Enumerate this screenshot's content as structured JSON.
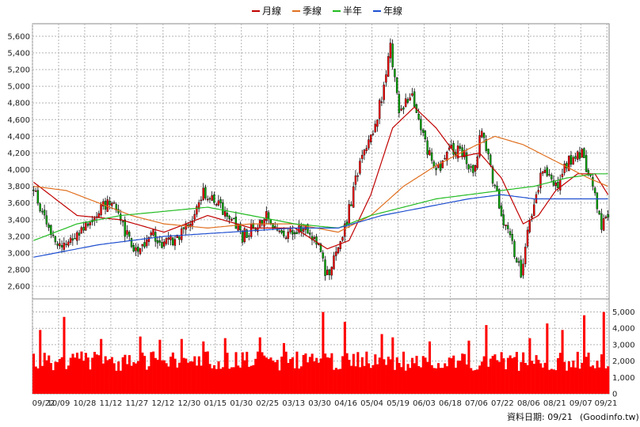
{
  "chart_data": {
    "type": "candlestick",
    "legend": {
      "placement": "top-center",
      "items": [
        {
          "name": "月線",
          "color": "#c00000"
        },
        {
          "name": "季線",
          "color": "#e07020"
        },
        {
          "name": "半年",
          "color": "#22bb22"
        },
        {
          "name": "年線",
          "color": "#1f4fd0"
        }
      ]
    },
    "colors": {
      "up": "#ff0000",
      "down": "#00aa00",
      "volume": "#ff0000",
      "grid": "#b4b4b4"
    },
    "price_axis": {
      "range": [
        2450,
        5750
      ],
      "ticks": [
        "5,600",
        "5,400",
        "5,200",
        "5,000",
        "4,800",
        "4,600",
        "4,400",
        "4,200",
        "4,000",
        "3,800",
        "3,600",
        "3,400",
        "3,200",
        "3,000",
        "2,800",
        "2,600"
      ],
      "tick_values": [
        5600,
        5400,
        5200,
        5000,
        4800,
        4600,
        4400,
        4200,
        4000,
        3800,
        3600,
        3400,
        3200,
        3000,
        2800,
        2600
      ],
      "side": "left"
    },
    "volume_axis": {
      "range": [
        0,
        5800
      ],
      "ticks": [
        "5,000",
        "4,000",
        "3,000",
        "2,000",
        "1,000",
        "0"
      ],
      "tick_values": [
        5000,
        4000,
        3000,
        2000,
        1000,
        0
      ],
      "side": "right"
    },
    "x_ticks": [
      "09/22",
      "10/09",
      "10/28",
      "11/12",
      "11/27",
      "12/12",
      "12/30",
      "01/15",
      "01/30",
      "02/25",
      "03/13",
      "03/30",
      "04/16",
      "05/04",
      "05/19",
      "06/03",
      "06/18",
      "07/06",
      "07/22",
      "08/06",
      "08/21",
      "09/07",
      "09/21"
    ],
    "x_tick_index": [
      0,
      12,
      24,
      36,
      48,
      60,
      72,
      84,
      96,
      108,
      120,
      132,
      144,
      156,
      168,
      180,
      192,
      204,
      216,
      228,
      240,
      252,
      264
    ],
    "num_days": 265,
    "price_anchors": [
      [
        0,
        3780
      ],
      [
        6,
        3350
      ],
      [
        12,
        3050
      ],
      [
        18,
        3200
      ],
      [
        24,
        3300
      ],
      [
        30,
        3500
      ],
      [
        36,
        3650
      ],
      [
        42,
        3250
      ],
      [
        48,
        3000
      ],
      [
        54,
        3250
      ],
      [
        60,
        3100
      ],
      [
        66,
        3200
      ],
      [
        72,
        3350
      ],
      [
        78,
        3750
      ],
      [
        84,
        3600
      ],
      [
        90,
        3450
      ],
      [
        96,
        3200
      ],
      [
        102,
        3350
      ],
      [
        108,
        3450
      ],
      [
        114,
        3200
      ],
      [
        120,
        3250
      ],
      [
        126,
        3300
      ],
      [
        132,
        3050
      ],
      [
        134,
        2700
      ],
      [
        138,
        2900
      ],
      [
        144,
        3400
      ],
      [
        150,
        4100
      ],
      [
        156,
        4450
      ],
      [
        162,
        5100
      ],
      [
        164,
        5500
      ],
      [
        168,
        4700
      ],
      [
        174,
        4900
      ],
      [
        180,
        4300
      ],
      [
        186,
        4000
      ],
      [
        192,
        4250
      ],
      [
        198,
        4200
      ],
      [
        202,
        3950
      ],
      [
        206,
        4500
      ],
      [
        210,
        4000
      ],
      [
        216,
        3400
      ],
      [
        220,
        3100
      ],
      [
        224,
        2750
      ],
      [
        228,
        3400
      ],
      [
        234,
        4000
      ],
      [
        240,
        3800
      ],
      [
        246,
        4100
      ],
      [
        252,
        4200
      ],
      [
        258,
        3700
      ],
      [
        261,
        3300
      ],
      [
        264,
        3500
      ]
    ],
    "ma_anchors": {
      "月線": [
        [
          0,
          3850
        ],
        [
          20,
          3450
        ],
        [
          40,
          3400
        ],
        [
          60,
          3250
        ],
        [
          80,
          3450
        ],
        [
          100,
          3300
        ],
        [
          120,
          3300
        ],
        [
          135,
          3050
        ],
        [
          145,
          3150
        ],
        [
          155,
          3700
        ],
        [
          165,
          4500
        ],
        [
          175,
          4750
        ],
        [
          185,
          4500
        ],
        [
          195,
          4150
        ],
        [
          205,
          4200
        ],
        [
          215,
          3900
        ],
        [
          225,
          3350
        ],
        [
          232,
          3450
        ],
        [
          240,
          3750
        ],
        [
          250,
          3950
        ],
        [
          258,
          3950
        ],
        [
          264,
          3700
        ]
      ],
      "季線": [
        [
          0,
          3800
        ],
        [
          15,
          3750
        ],
        [
          30,
          3600
        ],
        [
          45,
          3450
        ],
        [
          60,
          3350
        ],
        [
          80,
          3300
        ],
        [
          100,
          3350
        ],
        [
          120,
          3350
        ],
        [
          140,
          3250
        ],
        [
          155,
          3450
        ],
        [
          170,
          3800
        ],
        [
          185,
          4050
        ],
        [
          200,
          4250
        ],
        [
          212,
          4400
        ],
        [
          225,
          4300
        ],
        [
          240,
          4100
        ],
        [
          255,
          3900
        ],
        [
          264,
          3800
        ]
      ],
      "半年": [
        [
          0,
          3150
        ],
        [
          20,
          3350
        ],
        [
          40,
          3450
        ],
        [
          60,
          3500
        ],
        [
          80,
          3550
        ],
        [
          100,
          3450
        ],
        [
          120,
          3350
        ],
        [
          140,
          3300
        ],
        [
          155,
          3450
        ],
        [
          170,
          3550
        ],
        [
          185,
          3650
        ],
        [
          200,
          3700
        ],
        [
          215,
          3750
        ],
        [
          230,
          3800
        ],
        [
          245,
          3900
        ],
        [
          258,
          3950
        ],
        [
          264,
          3950
        ]
      ],
      "年線": [
        [
          0,
          2950
        ],
        [
          30,
          3100
        ],
        [
          60,
          3200
        ],
        [
          90,
          3250
        ],
        [
          120,
          3300
        ],
        [
          140,
          3300
        ],
        [
          160,
          3450
        ],
        [
          180,
          3550
        ],
        [
          200,
          3650
        ],
        [
          215,
          3700
        ],
        [
          230,
          3650
        ],
        [
          250,
          3650
        ],
        [
          264,
          3650
        ]
      ]
    },
    "volume_spikes": [
      [
        3,
        3900
      ],
      [
        14,
        4700
      ],
      [
        31,
        3350
      ],
      [
        49,
        3500
      ],
      [
        58,
        3300
      ],
      [
        68,
        3350
      ],
      [
        78,
        3200
      ],
      [
        88,
        3400
      ],
      [
        104,
        3450
      ],
      [
        115,
        3100
      ],
      [
        133,
        5000
      ],
      [
        143,
        4400
      ],
      [
        160,
        3650
      ],
      [
        165,
        3450
      ],
      [
        182,
        3200
      ],
      [
        200,
        3250
      ],
      [
        208,
        4200
      ],
      [
        228,
        3400
      ],
      [
        236,
        4300
      ],
      [
        243,
        3900
      ],
      [
        253,
        4800
      ],
      [
        262,
        5000
      ]
    ],
    "date_note": "資料日期: 09/21",
    "source_note": "(Goodinfo.tw)"
  }
}
